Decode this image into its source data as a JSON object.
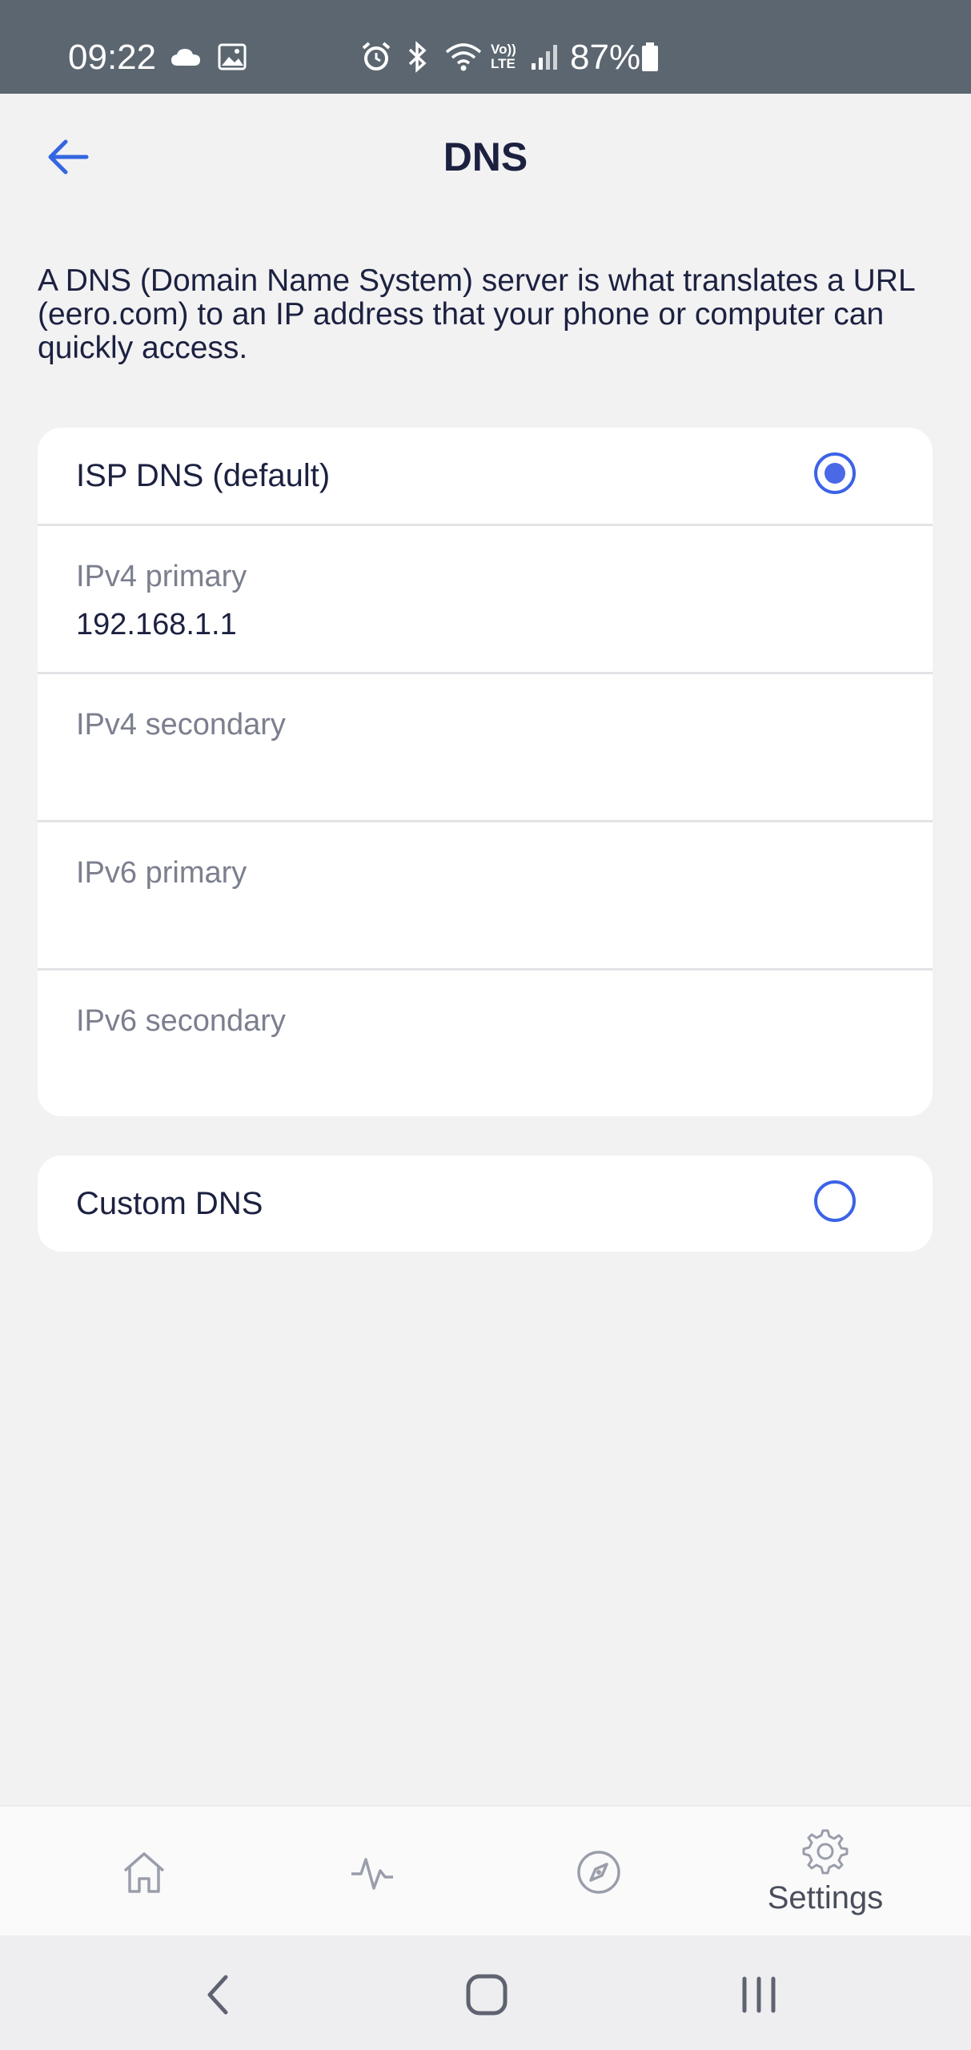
{
  "status_bar": {
    "time": "09:22",
    "battery": "87%",
    "icons": [
      "cloud-icon",
      "image-icon",
      "alarm-icon",
      "bluetooth-icon",
      "wifi-icon",
      "volte-icon",
      "signal-icon",
      "battery-icon"
    ],
    "volte_line1": "Vo))",
    "volte_line2": "LTE"
  },
  "header": {
    "title": "DNS",
    "back_icon": "arrow-left-icon"
  },
  "description": "A DNS (Domain Name System) server is what translates a URL (eero.com) to an IP address that your phone or computer can quickly access.",
  "isp_dns": {
    "label": "ISP DNS (default)",
    "selected": true,
    "fields": [
      {
        "label": "IPv4 primary",
        "value": "192.168.1.1"
      },
      {
        "label": "IPv4 secondary",
        "value": ""
      },
      {
        "label": "IPv6 primary",
        "value": ""
      },
      {
        "label": "IPv6 secondary",
        "value": ""
      }
    ]
  },
  "custom_dns": {
    "label": "Custom DNS",
    "selected": false
  },
  "bottom_nav": {
    "items": [
      {
        "icon": "home-icon"
      },
      {
        "icon": "activity-icon"
      },
      {
        "icon": "compass-icon"
      },
      {
        "icon": "gear-icon",
        "label": "Settings"
      }
    ]
  },
  "system_nav": {
    "buttons": [
      "back-icon",
      "home-icon",
      "recents-icon"
    ]
  },
  "colors": {
    "accent": "#3c63e6",
    "status_bar": "#5b6670",
    "background": "#f2f2f3",
    "text": "#1c2140",
    "muted": "#7b7f8e"
  }
}
